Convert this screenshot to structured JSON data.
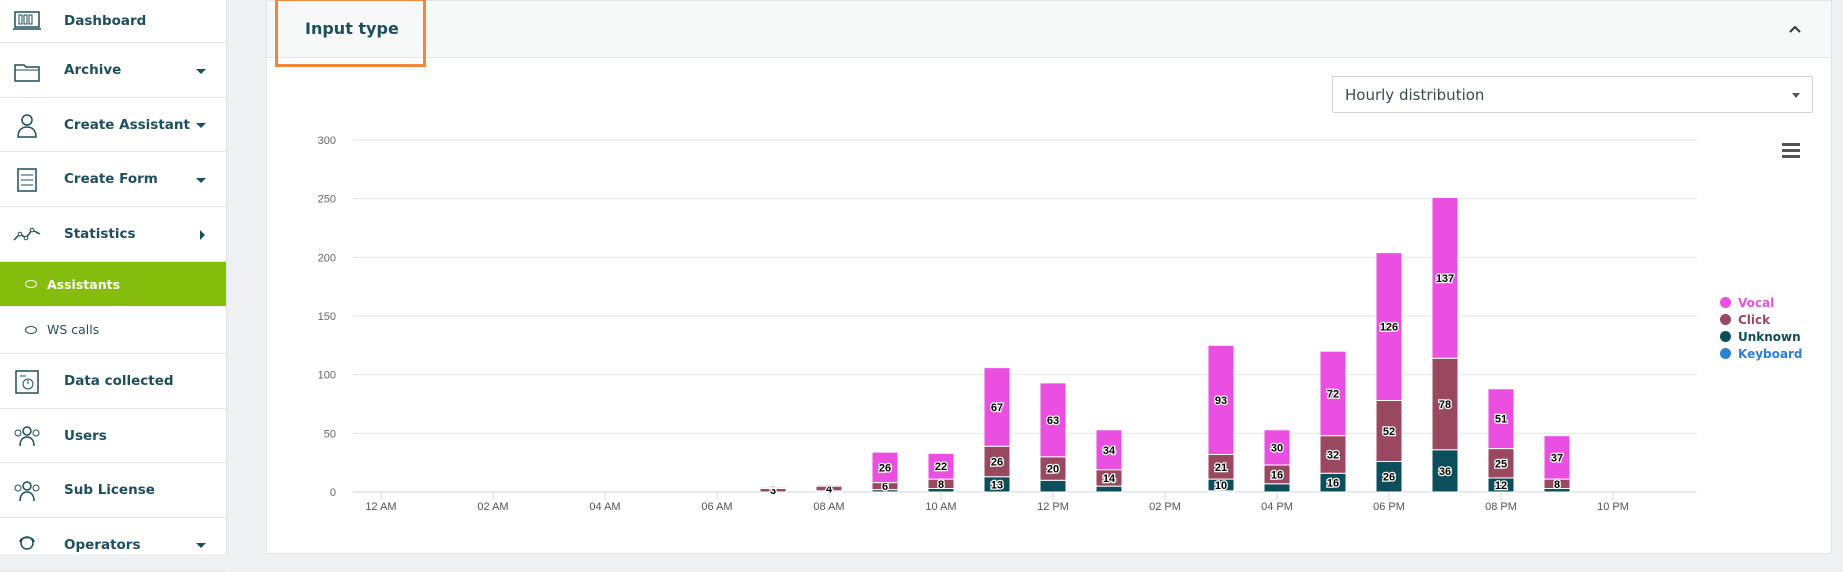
{
  "sidebar": {
    "items": [
      {
        "label": "Dashboard",
        "icon": "dashboard-icon",
        "toggle": "none"
      },
      {
        "label": "Archive",
        "icon": "folder-icon",
        "toggle": "down"
      },
      {
        "label": "Create Assistant",
        "icon": "assistant-icon",
        "toggle": "down"
      },
      {
        "label": "Create Form",
        "icon": "form-icon",
        "toggle": "down"
      },
      {
        "label": "Statistics",
        "icon": "statistics-icon",
        "toggle": "right"
      }
    ],
    "subitems": [
      {
        "label": "Assistants",
        "active": true
      },
      {
        "label": "WS calls",
        "active": false
      }
    ],
    "items2": [
      {
        "label": "Data collected",
        "icon": "data-collected-icon",
        "toggle": "none"
      },
      {
        "label": "Users",
        "icon": "users-icon",
        "toggle": "none"
      },
      {
        "label": "Sub License",
        "icon": "sub-license-icon",
        "toggle": "none"
      },
      {
        "label": "Operators",
        "icon": "operators-icon",
        "toggle": "down"
      }
    ]
  },
  "panel": {
    "title": "Input type",
    "collapse_icon": "chevron-up-icon",
    "select_value": "Hourly distribution",
    "menu_icon": "hamburger-menu-icon"
  },
  "colors": {
    "Vocal": "#ea4fe2",
    "Click": "#9a4760",
    "Unknown": "#0c4e5b",
    "Keyboard": "#2e7fd6",
    "accent_active": "#84bd0c",
    "highlight": "#f0873a"
  },
  "chart_data": {
    "type": "bar",
    "stacked": true,
    "title": "",
    "xlabel": "",
    "ylabel": "",
    "ylim": [
      0,
      300
    ],
    "yticks": [
      0,
      50,
      100,
      150,
      200,
      250,
      300
    ],
    "categories": [
      "12 AM",
      "01 AM",
      "02 AM",
      "03 AM",
      "04 AM",
      "05 AM",
      "06 AM",
      "07 AM",
      "08 AM",
      "09 AM",
      "10 AM",
      "11 AM",
      "12 PM",
      "01 PM",
      "02 PM",
      "03 PM",
      "04 PM",
      "05 PM",
      "06 PM",
      "07 PM",
      "08 PM",
      "09 PM",
      "10 PM",
      "11 PM"
    ],
    "xticks": [
      "12 AM",
      "02 AM",
      "04 AM",
      "06 AM",
      "08 AM",
      "10 AM",
      "12 PM",
      "02 PM",
      "04 PM",
      "06 PM",
      "08 PM",
      "10 PM"
    ],
    "series": [
      {
        "name": "Keyboard",
        "values": [
          0,
          0,
          0,
          0,
          0,
          0,
          0,
          0,
          0,
          0,
          0,
          0,
          0,
          0,
          0,
          1,
          0,
          0,
          0,
          0,
          0,
          0,
          0,
          0
        ],
        "labels": [
          null,
          null,
          null,
          null,
          null,
          null,
          null,
          null,
          null,
          null,
          null,
          null,
          null,
          null,
          null,
          null,
          null,
          null,
          null,
          null,
          null,
          null,
          null,
          null
        ]
      },
      {
        "name": "Unknown",
        "values": [
          0,
          0,
          0,
          0,
          0,
          0,
          0,
          0,
          1,
          2,
          3,
          13,
          10,
          5,
          0,
          10,
          7,
          16,
          26,
          36,
          12,
          3,
          0,
          0
        ],
        "labels": [
          null,
          null,
          null,
          null,
          null,
          null,
          null,
          null,
          null,
          null,
          null,
          13,
          null,
          null,
          null,
          10,
          null,
          16,
          26,
          36,
          12,
          null,
          null,
          null
        ]
      },
      {
        "name": "Click",
        "values": [
          0,
          0,
          0,
          0,
          0,
          0,
          0,
          3,
          4,
          6,
          8,
          26,
          20,
          14,
          0,
          21,
          16,
          32,
          52,
          78,
          25,
          8,
          0,
          0
        ],
        "labels": [
          null,
          null,
          null,
          null,
          null,
          null,
          null,
          3,
          4,
          6,
          8,
          26,
          20,
          14,
          null,
          21,
          16,
          32,
          52,
          78,
          25,
          8,
          null,
          null
        ]
      },
      {
        "name": "Vocal",
        "values": [
          0,
          0,
          0,
          0,
          0,
          0,
          0,
          1,
          1,
          26,
          22,
          67,
          63,
          34,
          0,
          93,
          30,
          72,
          126,
          137,
          51,
          37,
          0,
          0
        ],
        "labels": [
          null,
          null,
          null,
          null,
          null,
          null,
          null,
          null,
          null,
          26,
          22,
          67,
          63,
          34,
          null,
          93,
          30,
          72,
          126,
          137,
          51,
          37,
          null,
          null
        ]
      }
    ],
    "legend": {
      "position": "right",
      "order": [
        "Vocal",
        "Click",
        "Unknown",
        "Keyboard"
      ]
    },
    "grid": true
  }
}
